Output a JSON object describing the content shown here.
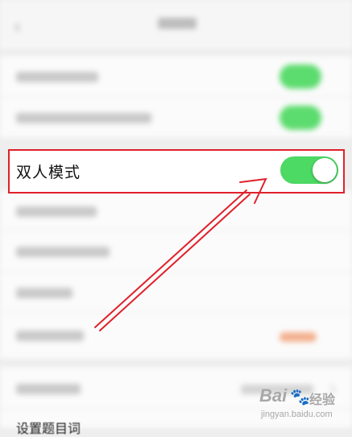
{
  "highlight": {
    "label": "双人模式",
    "toggle_on": true
  },
  "footer": {
    "partial_text": "设置题目词"
  },
  "watermark": {
    "brand": "Bai",
    "paw": "🐾",
    "suffix": "经验",
    "url": "jingyan.baidu.com"
  },
  "colors": {
    "toggle_on": "#4cd964",
    "highlight_border": "#e0212b",
    "arrow": "#e0212b"
  }
}
